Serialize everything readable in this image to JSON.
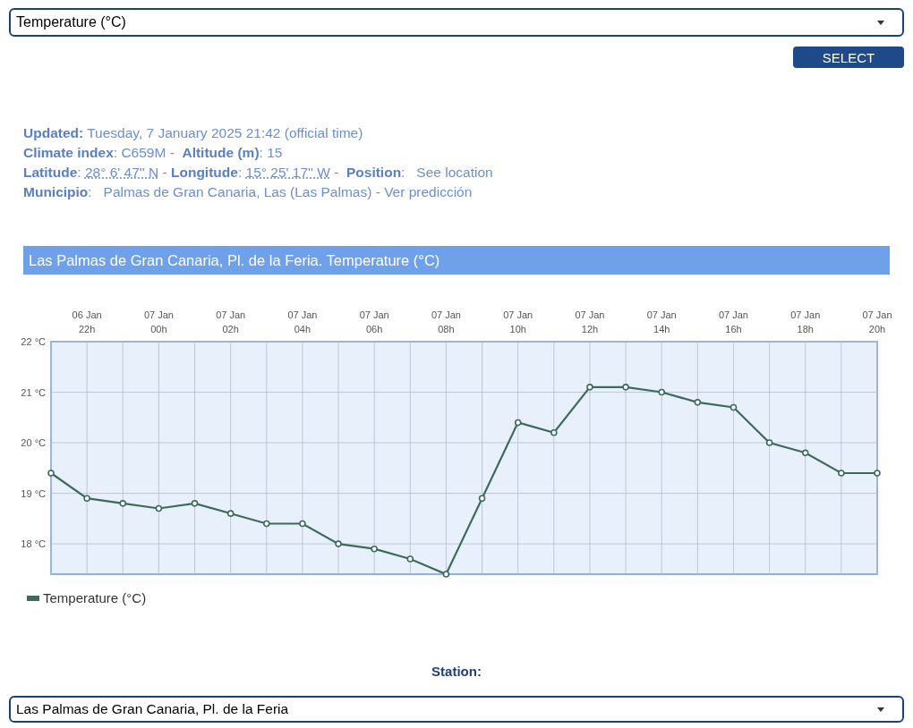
{
  "variable_select": {
    "value": "Temperature (°C)"
  },
  "select_button": {
    "label": "SELECT"
  },
  "info_lines": [
    [
      {
        "kind": "label",
        "text": "Updated:"
      },
      {
        "kind": "text",
        "text": " Tuesday, 7 January 2025 21:42 (official time)"
      }
    ],
    [
      {
        "kind": "label",
        "text": "Climate index"
      },
      {
        "kind": "text",
        "text": ": C659M -  "
      },
      {
        "kind": "label",
        "text": "Altitude (m)"
      },
      {
        "kind": "text",
        "text": ": 15"
      }
    ],
    [
      {
        "kind": "label",
        "text": "Latitude"
      },
      {
        "kind": "text",
        "text": ": "
      },
      {
        "kind": "abbr",
        "text": "28° 6' 47'' N"
      },
      {
        "kind": "text",
        "text": " - "
      },
      {
        "kind": "label",
        "text": "Longitude"
      },
      {
        "kind": "text",
        "text": ": "
      },
      {
        "kind": "abbr",
        "text": "15° 25' 17'' W"
      },
      {
        "kind": "text",
        "text": " -  "
      },
      {
        "kind": "label",
        "text": "Position"
      },
      {
        "kind": "text",
        "text": ":   "
      },
      {
        "kind": "link",
        "text": "See location"
      }
    ],
    [
      {
        "kind": "label",
        "text": "Municipio"
      },
      {
        "kind": "text",
        "text": ":   Palmas de Gran Canaria, Las (Las Palmas) - "
      },
      {
        "kind": "link",
        "text": "Ver predicción"
      }
    ]
  ],
  "chart": {
    "chart_data": {
      "type": "line",
      "title": "Las Palmas de Gran Canaria, Pl. de la Feria. Temperature (°C)",
      "categories": [
        null,
        "06 Jan 22h",
        null,
        "07 Jan 00h",
        null,
        "07 Jan 02h",
        null,
        "07 Jan 04h",
        null,
        "07 Jan 06h",
        null,
        "07 Jan 08h",
        null,
        "07 Jan 10h",
        null,
        "07 Jan 12h",
        null,
        "07 Jan 14h",
        null,
        "07 Jan 16h",
        null,
        "07 Jan 18h",
        null,
        "07 Jan 20h"
      ],
      "series": [
        {
          "name": "Temperature (°C)",
          "color": "#3d6b5b",
          "marker": "circle",
          "values": [
            19.4,
            18.9,
            18.8,
            18.7,
            18.8,
            18.6,
            18.4,
            18.4,
            18.0,
            17.9,
            17.7,
            17.4,
            18.9,
            20.4,
            20.2,
            21.1,
            21.1,
            21.0,
            20.8,
            20.7,
            20.0,
            19.8,
            19.4,
            19.4
          ]
        }
      ],
      "ylim": [
        17.4,
        22
      ],
      "grid": true,
      "yticks": [
        {
          "value": 18,
          "label": "18 °C"
        },
        {
          "value": 19,
          "label": "19 °C"
        },
        {
          "value": 20,
          "label": "20 °C"
        },
        {
          "value": 21,
          "label": "21 °C"
        },
        {
          "value": 22,
          "label": "22 °C"
        }
      ]
    }
  },
  "station_label": "Station:",
  "station_select": {
    "value": "Las Palmas de Gran Canaria, Pl. de la Feria"
  }
}
